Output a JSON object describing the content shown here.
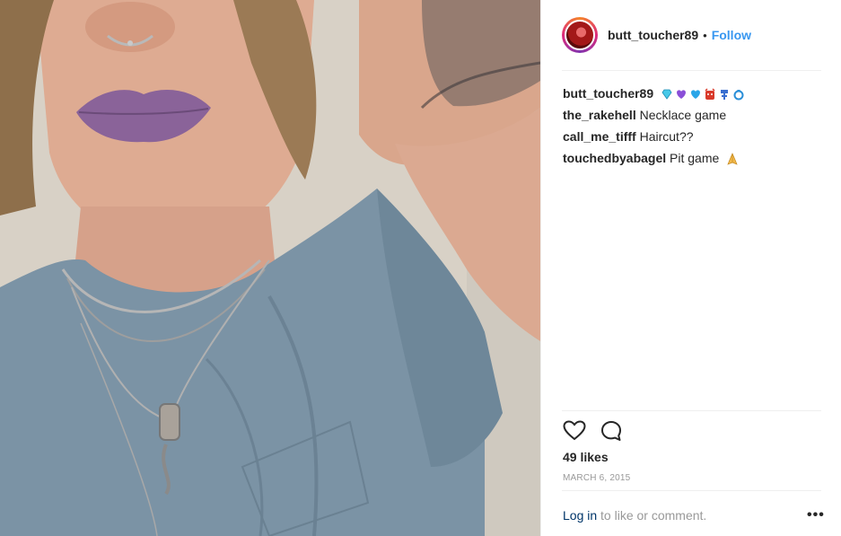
{
  "post": {
    "author": {
      "username": "butt_toucher89",
      "separator": "•",
      "follow_label": "Follow"
    },
    "icons": {
      "like": "heart-outline-icon",
      "comment": "speech-bubble-icon",
      "more": "more-options-icon"
    },
    "comments": [
      {
        "user": "butt_toucher89",
        "text": "",
        "emojis": [
          "diamond-icon",
          "purple-heart-icon",
          "blue-heart-icon",
          "devil-icon",
          "tiki-icon",
          "ring-icon"
        ]
      },
      {
        "user": "the_rakehell",
        "text": "Necklace game"
      },
      {
        "user": "call_me_tifff",
        "text": "Haircut??"
      },
      {
        "user": "touchedbyabagel",
        "text": "Pit game",
        "emojis": [
          "praying-hands-icon"
        ]
      }
    ],
    "likes": "49 likes",
    "date": "MARCH 6, 2015",
    "login": {
      "link_label": "Log in",
      "rest_text": "to like or comment.",
      "more_label": "•••"
    },
    "colors": {
      "accent": "#3897f0",
      "text": "#262626",
      "muted": "#999999"
    }
  }
}
